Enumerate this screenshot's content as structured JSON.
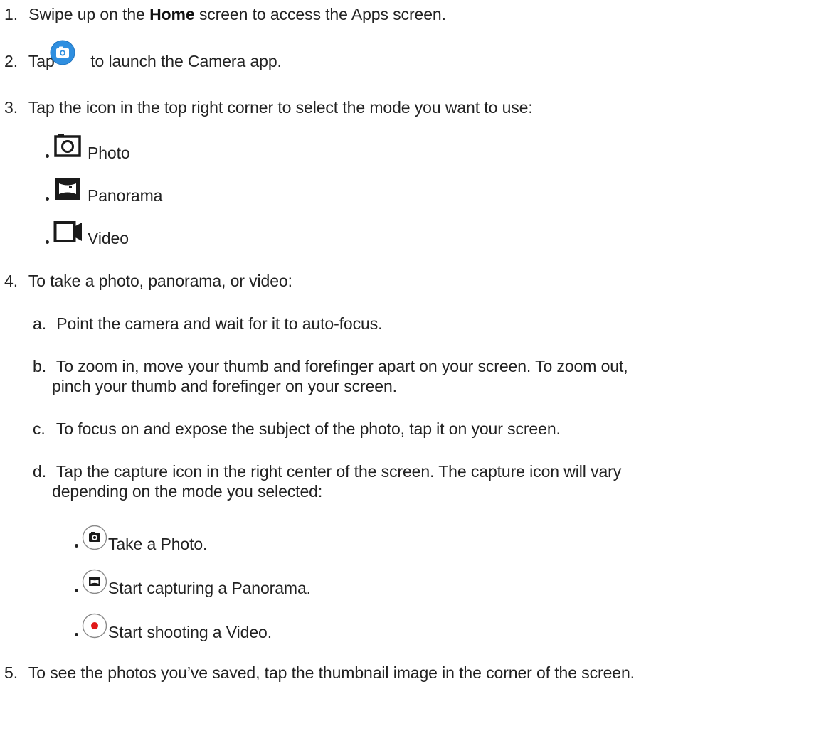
{
  "steps": {
    "step1": {
      "number": "1.",
      "text_before": "Swipe up on the",
      "bold": "Home",
      "text_after": "screen to access the Apps screen."
    },
    "step2": {
      "number": "2.",
      "text_before": "Tap",
      "text_after": "to launch the Camera app.",
      "icon": "camera-app-icon"
    },
    "step3": {
      "number": "3.",
      "text": "Tap the icon in the top right corner to select the mode you want to use:",
      "modes": [
        {
          "icon": "photo-mode-icon",
          "label": "Photo"
        },
        {
          "icon": "panorama-mode-icon",
          "label": "Panorama"
        },
        {
          "icon": "video-mode-icon",
          "label": "Video"
        }
      ]
    },
    "step4": {
      "number": "4.",
      "text": "To take a photo, panorama, or video:",
      "substeps": [
        {
          "letter": "a.",
          "lines": [
            "Point the camera and wait for it to auto-focus."
          ]
        },
        {
          "letter": "b.",
          "lines": [
            "To zoom in, move your thumb and forefinger apart on your screen. To zoom out,",
            "pinch your thumb and forefinger on your screen."
          ]
        },
        {
          "letter": "c.",
          "lines": [
            "To focus on and expose the subject of the photo, tap it on your screen."
          ]
        },
        {
          "letter": "d.",
          "lines": [
            "Tap the capture icon in the right center of the screen. The capture icon will vary",
            "depending on the mode you selected:"
          ]
        }
      ],
      "capture_icons": [
        {
          "icon": "capture-photo-icon",
          "label": "Take a Photo."
        },
        {
          "icon": "capture-panorama-icon",
          "label": "Start capturing a Panorama."
        },
        {
          "icon": "record-video-icon",
          "label": "Start shooting a Video."
        }
      ]
    },
    "step5": {
      "number": "5.",
      "text": "To see the photos you’ve saved, tap the thumbnail image in the corner of the screen."
    }
  },
  "colors": {
    "text": "#222222",
    "camera_app_icon": "#2f8fe0",
    "record_dot": "#e01818"
  }
}
